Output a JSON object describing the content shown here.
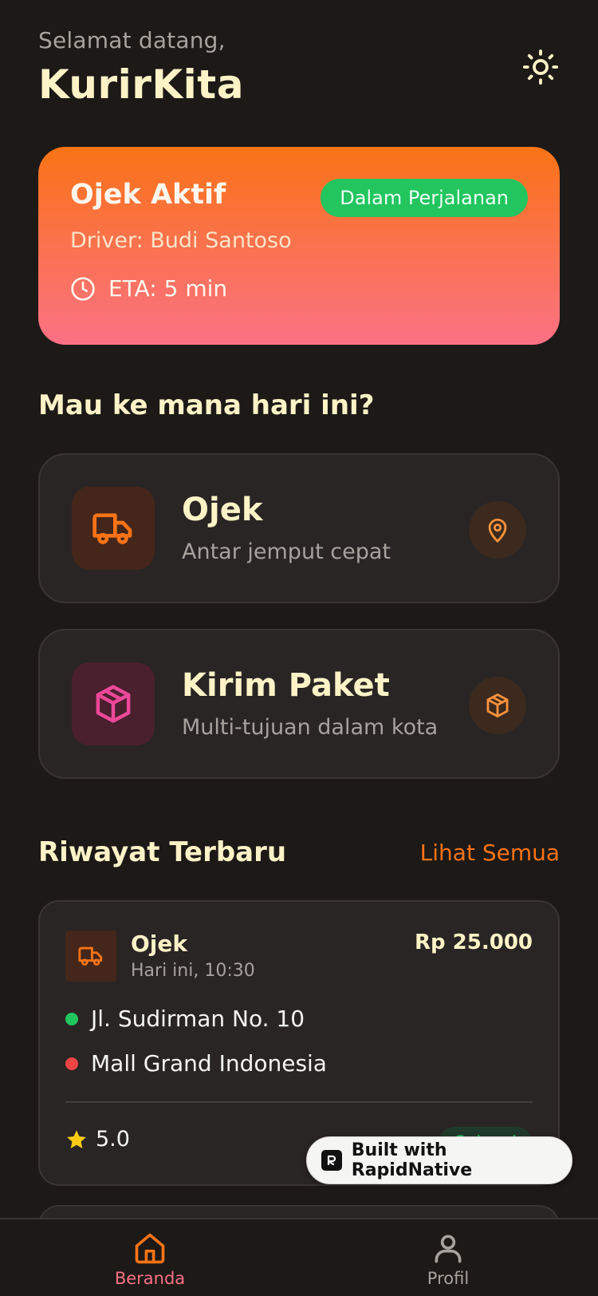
{
  "header": {
    "greeting": "Selamat datang,",
    "title": "KurirKita",
    "theme_icon": "sun-icon"
  },
  "active_ride": {
    "title": "Ojek Aktif",
    "status": "Dalam Perjalanan",
    "driver": "Driver: Budi Santoso",
    "eta": "ETA: 5 min",
    "gradient_colors": [
      "#f97316",
      "#fb7185"
    ],
    "status_color": "#22c55e"
  },
  "services": {
    "heading": "Mau ke mana hari ini?",
    "items": [
      {
        "title": "Ojek",
        "subtitle": "Antar jemput cepat",
        "icon": "truck-icon",
        "action_icon": "map-pin-icon",
        "accent": "#f97316"
      },
      {
        "title": "Kirim Paket",
        "subtitle": "Multi-tujuan dalam kota",
        "icon": "package-icon",
        "action_icon": "package-icon",
        "accent": "#ec4899"
      }
    ]
  },
  "history": {
    "heading": "Riwayat Terbaru",
    "see_all": "Lihat Semua",
    "items": [
      {
        "type": "Ojek",
        "time": "Hari ini, 10:30",
        "price": "Rp 25.000",
        "pickup": "Jl. Sudirman No. 10",
        "dropoff": "Mall Grand Indonesia",
        "rating": "5.0",
        "status": "Selesai"
      }
    ]
  },
  "badge": {
    "text": "Built with RapidNative"
  },
  "nav": {
    "items": [
      {
        "label": "Beranda",
        "icon": "home-icon",
        "active": true
      },
      {
        "label": "Profil",
        "icon": "user-icon",
        "active": false
      }
    ],
    "active_color": "#f97316"
  }
}
